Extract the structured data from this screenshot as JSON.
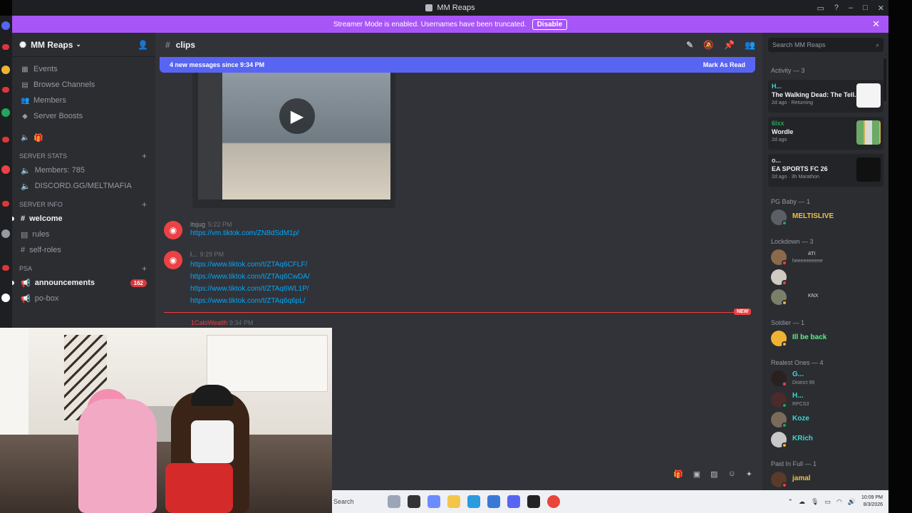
{
  "window": {
    "title": "MM Reaps"
  },
  "banner": {
    "text": "Streamer Mode is enabled. Usernames have been truncated.",
    "button": "Disable"
  },
  "server": {
    "name": "MM Reaps",
    "nav": [
      {
        "label": "Events",
        "icon": "calendar-icon"
      },
      {
        "label": "Browse Channels",
        "icon": "browse-icon"
      },
      {
        "label": "Members",
        "icon": "members-icon"
      },
      {
        "label": "Server Boosts",
        "icon": "boost-icon"
      }
    ],
    "stats_category": "SERVER STATS",
    "stats": [
      {
        "label": "Members: 785"
      },
      {
        "label": "DISCORD.GG/MELTMAFIA"
      }
    ],
    "info_category": "SERVER INFO",
    "info_channels": [
      {
        "label": "welcome",
        "bold": true
      },
      {
        "label": "rules",
        "bold": false
      },
      {
        "label": "self-roles",
        "bold": false
      }
    ],
    "psa_category": "PSA",
    "psa_channels": [
      {
        "label": "announcements",
        "badge": "162"
      },
      {
        "label": "po-box"
      }
    ]
  },
  "channel": {
    "name": "clips"
  },
  "new_messages": {
    "text": "4 new messages since 9:34 PM",
    "action": "Mark As Read"
  },
  "messages": [
    {
      "user": "itsjug",
      "time": "5:22 PM",
      "links": [
        "https://vm.tiktok.com/ZN8dSdM1p/"
      ]
    },
    {
      "user": "l...",
      "time": "9:29 PM",
      "links": [
        "https://www.tiktok.com/t/ZTAq6CFLF/",
        "https://www.tiktok.com/t/ZTAq6CwDA/",
        "https://www.tiktok.com/t/ZTAq6WL1P/",
        "https://www.tiktok.com/t/ZTAq6q6pL/"
      ]
    }
  ],
  "new_divider": "NEW",
  "partial_message": {
    "user": "1CaloWealth",
    "time": "9:34 PM"
  },
  "members": {
    "search_placeholder": "Search MM Reaps",
    "activity_header": "Activity — 3",
    "activities": [
      {
        "name": "H...",
        "game": "The Walking Dead: The Tell...",
        "detail": "2d ago · Returning",
        "thumb": "#f4f4f4"
      },
      {
        "name": "6lxx",
        "game": "Wordle",
        "detail": "2d ago",
        "thumb": "#d9d9d9"
      },
      {
        "name": "o...",
        "game": "EA SPORTS FC 26",
        "detail": "2d ago · 3h Marathon",
        "thumb": "#111111"
      }
    ],
    "groups": [
      {
        "header": "PG Baby — 1",
        "members": [
          {
            "name": "MELTISLIVE",
            "color": "#f0c040",
            "status": ""
          }
        ]
      },
      {
        "header": "Lockdown — 3",
        "members": [
          {
            "name": "",
            "color": "#6d6f78",
            "status": "heeeeeeeeee",
            "tag": "ATI"
          },
          {
            "name": "",
            "color": "#6d6f78",
            "status": ""
          },
          {
            "name": "",
            "color": "#6d6f78",
            "status": "",
            "tag": "KNX"
          }
        ]
      },
      {
        "header": "Soldier — 1",
        "members": [
          {
            "name": "Ill be back",
            "color": "#57f287",
            "status": ""
          }
        ]
      },
      {
        "header": "Realest Ones — 4",
        "members": [
          {
            "name": "G...",
            "color": "#3dd6d0",
            "status": "District 99"
          },
          {
            "name": "H...",
            "color": "#3dd6d0",
            "status": "RPCS3"
          },
          {
            "name": "Koze",
            "color": "#3dd6d0",
            "status": ""
          },
          {
            "name": "KRich",
            "color": "#3dd6d0",
            "status": ""
          }
        ]
      },
      {
        "header": "Paid In Full — 1",
        "members": [
          {
            "name": "jamal",
            "color": "#f0c040",
            "status": ""
          }
        ]
      }
    ]
  },
  "taskbar": {
    "search": "Search",
    "time": "10:09 PM",
    "date": "8/3/2026"
  }
}
